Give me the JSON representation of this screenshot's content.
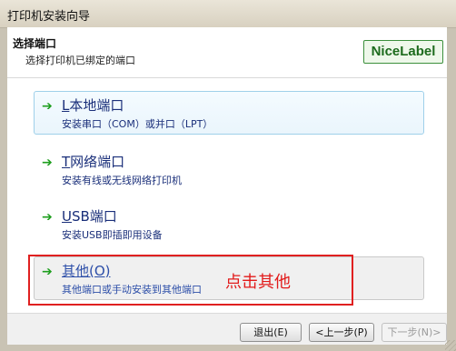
{
  "window": {
    "title": "打印机安装向导"
  },
  "header": {
    "title": "选择端口",
    "subtitle": "选择打印机已绑定的端口",
    "logo_text": "NiceLabel"
  },
  "options": [
    {
      "key": "L",
      "label_rest": "本地端口",
      "description": "安装串口（COM）或并口（LPT）",
      "state": "highlighted"
    },
    {
      "key": "T",
      "label_rest": "网络端口",
      "description": "安装有线或无线网络打印机",
      "state": "normal"
    },
    {
      "key": "U",
      "label_rest": "SB端口",
      "description": "安装USB即插即用设备",
      "state": "normal"
    },
    {
      "key": "其他(O)",
      "label_rest": "",
      "description": "其他端口或手动安装到其他端口",
      "state": "selected"
    }
  ],
  "annotation": {
    "text": "点击其他",
    "color": "#e21a1a"
  },
  "buttons": {
    "exit": "退出(E)",
    "prev": "<上一步(P)",
    "next": "下一步(N)>"
  },
  "colors": {
    "accent_green": "#1e9e1e",
    "link_blue": "#1a2f7a",
    "annotation_red": "#e02020"
  }
}
